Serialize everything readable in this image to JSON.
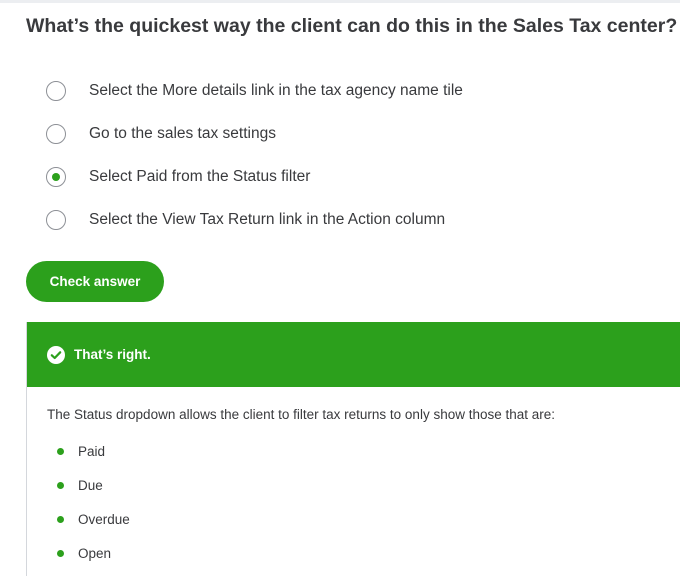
{
  "question": "What’s the quickest way the client can do this in the Sales Tax center?",
  "options": [
    {
      "label": "Select the More details link in the tax agency name tile",
      "selected": false
    },
    {
      "label": "Go to the sales tax settings",
      "selected": false
    },
    {
      "label": "Select Paid from the Status filter",
      "selected": true
    },
    {
      "label": "Select the View Tax Return link in the Action column",
      "selected": false
    }
  ],
  "check_button_label": "Check answer",
  "feedback": {
    "title": "That’s right.",
    "text": "The Status dropdown allows the client to filter tax returns to only show those that are:",
    "bullets": [
      "Paid",
      "Due",
      "Overdue",
      "Open"
    ]
  },
  "colors": {
    "accent": "#2ca01c",
    "text": "#393a3d",
    "radio_border": "#8d9096"
  },
  "icons": {
    "feedback_icon": "check-circle-icon",
    "bullet_icon": "bullet-dot-icon"
  }
}
